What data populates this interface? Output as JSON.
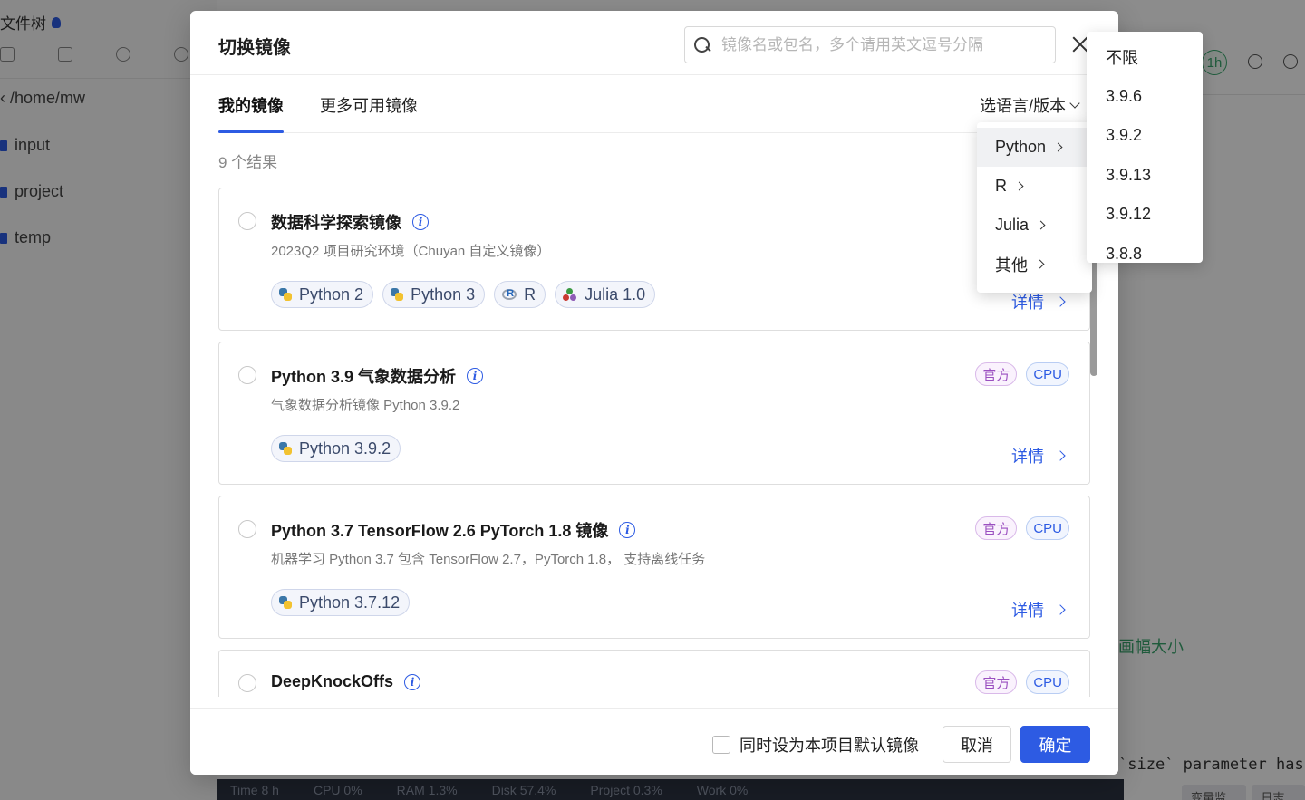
{
  "background": {
    "tree_title": "文件树",
    "path": "/home/mw",
    "folders": [
      "input",
      "project",
      "temp"
    ],
    "right_badge": "1h",
    "code_text": "画幅大小",
    "code_mono": "`size` parameter has",
    "monitor_tabs": [
      "变量监控",
      "日志账"
    ],
    "status": [
      {
        "label": "Time",
        "value": "8 h"
      },
      {
        "label": "CPU",
        "value": "0%"
      },
      {
        "label": "RAM",
        "value": "1.3%"
      },
      {
        "label": "Disk",
        "value": "57.4%"
      },
      {
        "label": "Project",
        "value": "0.3%"
      },
      {
        "label": "Work",
        "value": "0%"
      }
    ]
  },
  "modal": {
    "title": "切换镜像",
    "search_placeholder": "镜像名或包名，多个请用英文逗号分隔",
    "tabs": [
      "我的镜像",
      "更多可用镜像"
    ],
    "lang_select_label": "选语言/版本",
    "result_count": "9 个结果",
    "details_label": "详情",
    "cards": [
      {
        "name": "数据科学探索镜像",
        "desc": "2023Q2 项目研究环境（Chuyan 自定义镜像）",
        "chips": [
          {
            "icon": "python-icon",
            "label": "Python 2"
          },
          {
            "icon": "python-icon",
            "label": "Python 3"
          },
          {
            "icon": "r-icon",
            "label": "R"
          },
          {
            "icon": "julia-icon",
            "label": "Julia 1.0"
          }
        ],
        "badges": []
      },
      {
        "name": "Python 3.9 气象数据分析",
        "desc": "气象数据分析镜像 Python 3.9.2",
        "chips": [
          {
            "icon": "python-icon",
            "label": "Python 3.9.2"
          }
        ],
        "badges": [
          "官方",
          "CPU"
        ]
      },
      {
        "name": "Python 3.7 TensorFlow 2.6 PyTorch 1.8 镜像",
        "desc": "机器学习 Python 3.7 包含 TensorFlow 2.7，PyTorch 1.8， 支持离线任务",
        "chips": [
          {
            "icon": "python-icon",
            "label": "Python 3.7.12"
          }
        ],
        "badges": [
          "官方",
          "CPU"
        ]
      },
      {
        "name": "DeepKnockOffs",
        "desc": "",
        "chips": [],
        "badges": [
          "官方",
          "CPU"
        ]
      }
    ],
    "footer_checkbox_label": "同时设为本项目默认镜像",
    "cancel_label": "取消",
    "ok_label": "确定"
  },
  "lang_dropdown": [
    "Python",
    "R",
    "Julia",
    "其他"
  ],
  "version_dropdown": [
    "不限",
    "3.9.6",
    "3.9.2",
    "3.9.13",
    "3.9.12",
    "3.8.8"
  ],
  "colors": {
    "accent": "#2d5be3",
    "official_badge": "#9a4fc0",
    "cpu_badge": "#2d5be3",
    "success": "#3aa76d"
  }
}
